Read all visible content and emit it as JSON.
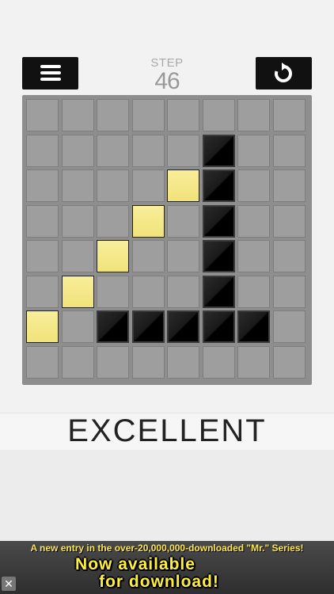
{
  "header": {
    "step_label": "STEP",
    "step_count": "46"
  },
  "board": {
    "rows": 8,
    "cols": 8,
    "black_cells": [
      [
        1,
        5
      ],
      [
        2,
        5
      ],
      [
        3,
        5
      ],
      [
        4,
        5
      ],
      [
        5,
        5
      ],
      [
        6,
        2
      ],
      [
        6,
        3
      ],
      [
        6,
        4
      ],
      [
        6,
        5
      ],
      [
        6,
        6
      ]
    ],
    "yellow_cells": [
      [
        2,
        4
      ],
      [
        3,
        3
      ],
      [
        4,
        2
      ],
      [
        5,
        1
      ],
      [
        6,
        0
      ]
    ]
  },
  "result": {
    "text": "EXCELLENT"
  },
  "ad": {
    "top_text": "A new entry in the over-20,000,000-downloaded \"Mr.\" Series!",
    "line1": "Now available",
    "line2": "for download!",
    "close_label": "✕"
  },
  "colors": {
    "background": "#f2f2f2",
    "board": "#8e8e8e",
    "cell": "#9e9e9e",
    "black_tile": "#000000",
    "yellow_tile": "#f1e27a",
    "ad_text": "#ffef3a"
  }
}
